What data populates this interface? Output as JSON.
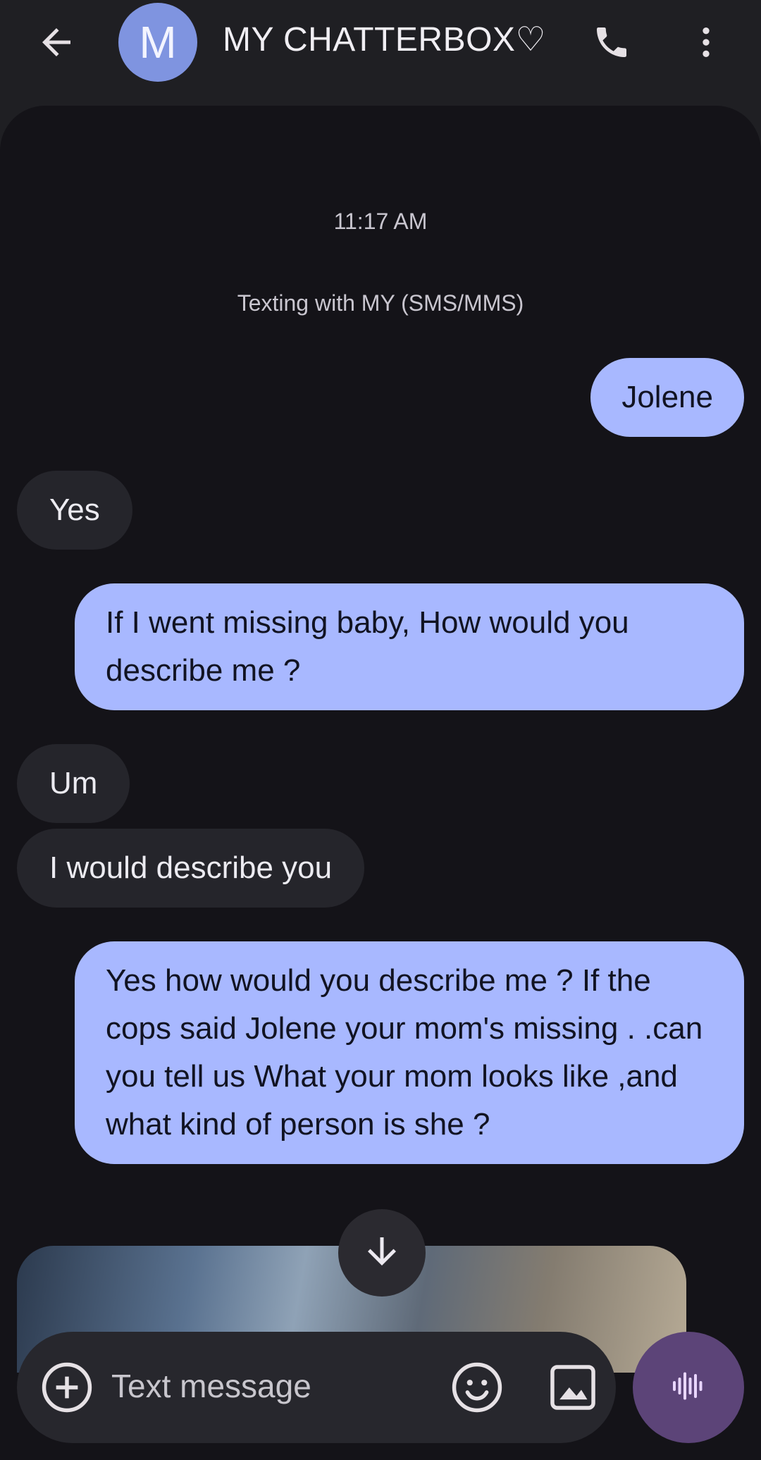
{
  "header": {
    "avatar_letter": "M",
    "title": "MY CHATTERBOX♡",
    "back_icon": "arrow-left-icon",
    "call_icon": "phone-icon",
    "more_icon": "more-vert-icon"
  },
  "conversation": {
    "timestamp": "11:17 AM",
    "info": "Texting with MY (SMS/MMS)",
    "messages": [
      {
        "direction": "outgoing",
        "text": "Jolene"
      },
      {
        "direction": "incoming",
        "text": "Yes"
      },
      {
        "direction": "outgoing",
        "text": "If I went missing baby, How would you describe me ?"
      },
      {
        "direction": "incoming",
        "text": "Um"
      },
      {
        "direction": "incoming",
        "text": "I would describe you"
      },
      {
        "direction": "outgoing",
        "text": "Yes how would you describe me ? If the cops said Jolene your mom's missing . .can you tell us What your mom looks like ,and what kind of person  is she ?"
      }
    ]
  },
  "composer": {
    "placeholder": "Text message",
    "icons": [
      "add-circle-icon",
      "emoji-icon",
      "gallery-icon",
      "voice-waveform-icon"
    ]
  },
  "colors": {
    "outgoing_bubble": "#a8b8ff",
    "incoming_bubble": "#25252b",
    "background": "#141318",
    "voice_button": "#5c4478"
  }
}
